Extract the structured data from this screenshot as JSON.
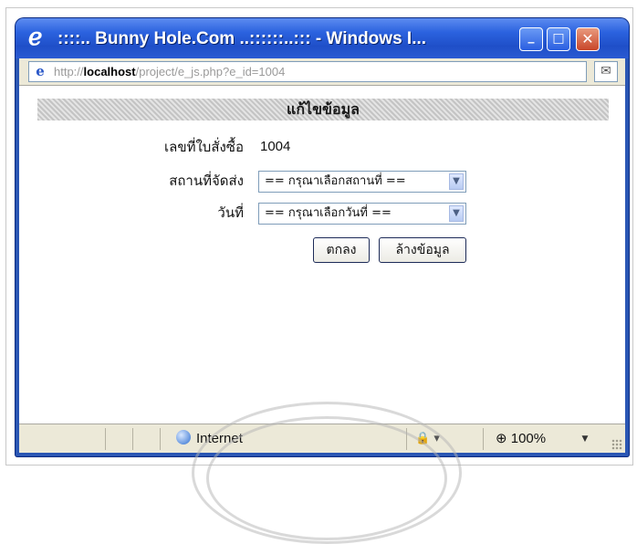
{
  "window": {
    "title": "::::.. Bunny Hole.Com ..::::::..::: - Windows I...",
    "minimize_glyph": "_",
    "maximize_glyph": "□",
    "close_glyph": "✕"
  },
  "address_bar": {
    "prefix": "http://",
    "host": "localhost",
    "path": "/project/e_js.php?e_id=1004"
  },
  "form": {
    "heading": "แก้ไขข้อมูล",
    "order_label": "เลขที่ใบสั่งซื้อ",
    "order_value": "1004",
    "location_label": "สถานที่จัดส่ง",
    "location_select": "== กรุณาเลือกสถานที่ ==",
    "date_label": "วันที่",
    "date_select": "== กรุณาเลือกวันที่ ==",
    "ok_button": "ตกลง",
    "clear_button": "ล้างข้อมูล"
  },
  "status_bar": {
    "zone": "Internet",
    "zoom": "100%"
  },
  "icons": {
    "title": "ie-logo-icon",
    "page": "ie-page-icon",
    "address_action": "compatibility-view-icon",
    "zone": "globe-icon",
    "security": "protected-mode-icon",
    "zoom": "zoom-icon"
  }
}
